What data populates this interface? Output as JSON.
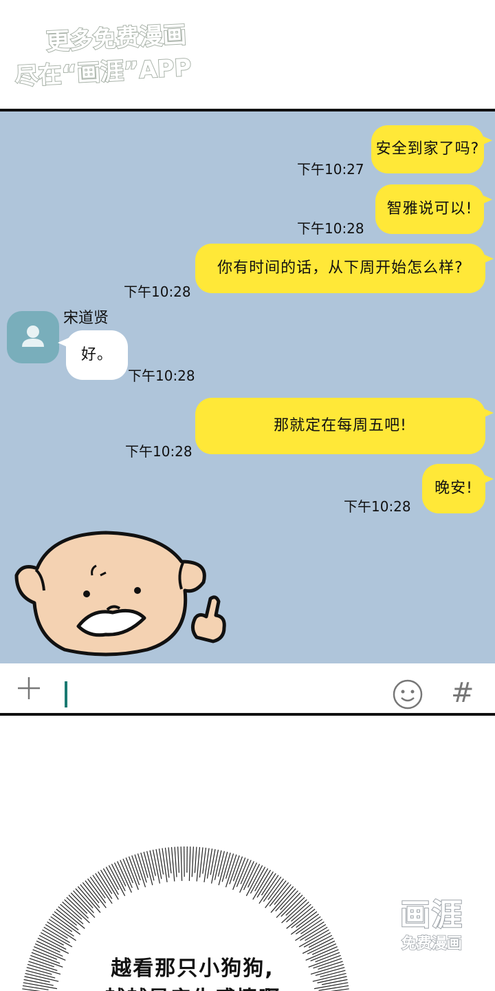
{
  "watermark": {
    "line1": "更多免费漫画",
    "line2": "尽在“画涯”APP"
  },
  "chat": {
    "messages": [
      {
        "text": "安全到家了吗?",
        "time": "下午10:27",
        "direction": "out"
      },
      {
        "text": "智雅说可以!",
        "time": "下午10:28",
        "direction": "out"
      },
      {
        "text": "你有时间的话，从下周开始怎么样?",
        "time": "下午10:28",
        "direction": "out"
      },
      {
        "text": "好。",
        "time": "下午10:28",
        "direction": "in",
        "sender": "宋道贤"
      },
      {
        "text": "那就定在每周五吧!",
        "time": "下午10:28",
        "direction": "out"
      },
      {
        "text": "晚安!",
        "time": "下午10:28",
        "direction": "out"
      }
    ],
    "sticker": "dog-thumbs-up-sticker"
  },
  "input_bar": {
    "icons": [
      "plus-icon",
      "smiley-icon",
      "hash-icon"
    ],
    "hash": "#"
  },
  "narration": {
    "line1": "越看那只小狗狗,",
    "line2": "越越是产生感情啊"
  },
  "logo": {
    "mark": "画涯",
    "sub": "免费漫画"
  },
  "colors": {
    "chat_bg": "#afc5da",
    "outgoing_bubble": "#ffe838",
    "incoming_bubble": "#ffffff",
    "avatar": "#79aebb"
  }
}
